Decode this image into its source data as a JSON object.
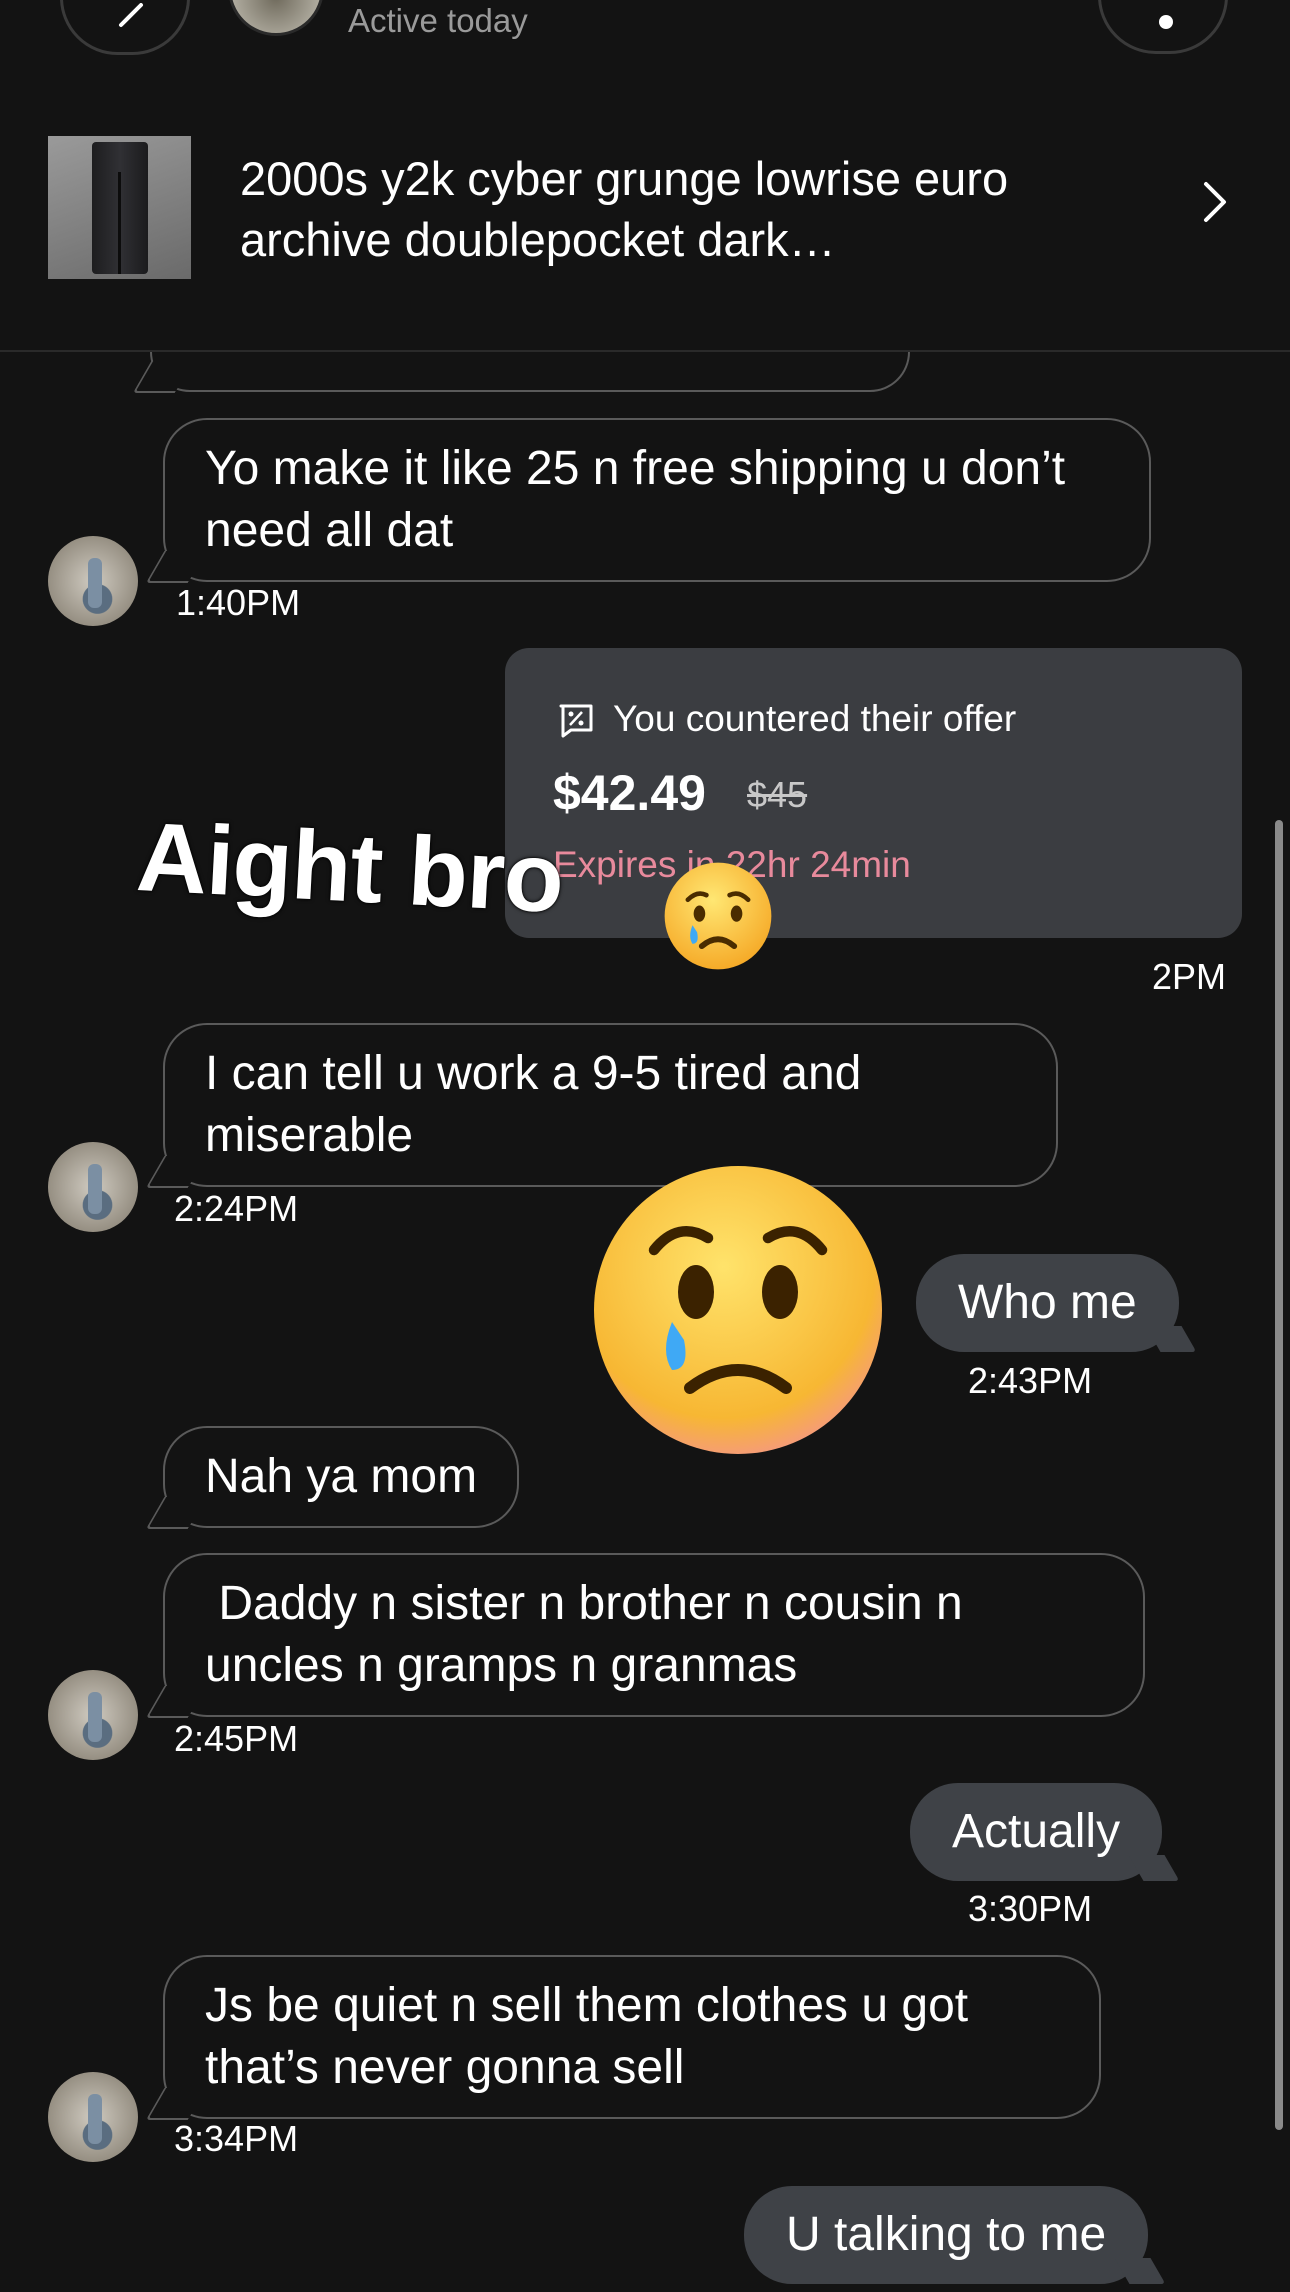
{
  "header": {
    "active_status": "Active today",
    "listing_title": "2000s y2k cyber grunge lowrise euro archive doublepocket dark…"
  },
  "messages": [
    {
      "from": "them",
      "text": "Yo make it like 25 n free shipping u don’t need all dat",
      "time": "1:40PM"
    },
    {
      "from": "them",
      "text": "I can tell u work a 9-5 tired and miserable",
      "time": "2:24PM"
    },
    {
      "from": "me",
      "text": "Who me",
      "time": "2:43PM"
    },
    {
      "from": "them",
      "text": "Nah ya mom"
    },
    {
      "from": "them",
      "text": " Daddy n sister n brother n cousin n uncles n gramps n granmas",
      "time": "2:45PM"
    },
    {
      "from": "me",
      "text": "Actually",
      "time": "3:30PM"
    },
    {
      "from": "them",
      "text": "Js be quiet n sell them clothes u got that’s never gonna sell",
      "time": "3:34PM"
    },
    {
      "from": "me",
      "text": "U talking to me"
    }
  ],
  "offer": {
    "label": "You countered their offer",
    "price": "$42.49",
    "original_price": "$45",
    "expires": "Expires in 22hr 24min",
    "time": "2PM"
  },
  "sticker": {
    "text": "Aight bro",
    "small_emoji": "crying-face-emoji",
    "big_emoji": "crying-face-emoji"
  },
  "colors": {
    "background": "#131313",
    "incoming_border": "#5a5a5a",
    "outgoing_bubble": "#3f4247",
    "offer_card": "#3b3d41",
    "expires_text": "#e88a9c"
  }
}
